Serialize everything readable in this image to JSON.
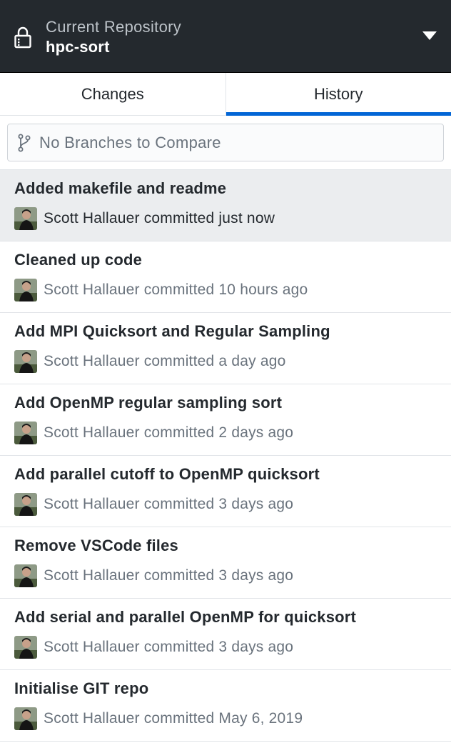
{
  "header": {
    "label": "Current Repository",
    "repo_name": "hpc-sort"
  },
  "tabs": [
    {
      "label": "Changes",
      "selected": false
    },
    {
      "label": "History",
      "selected": true
    }
  ],
  "compare": {
    "placeholder": "No Branches to Compare"
  },
  "commits": [
    {
      "summary": "Added makefile and readme",
      "byline": "Scott Hallauer committed just now",
      "selected": true
    },
    {
      "summary": "Cleaned up code",
      "byline": "Scott Hallauer committed 10 hours ago",
      "selected": false
    },
    {
      "summary": "Add MPI Quicksort and Regular Sampling",
      "byline": "Scott Hallauer committed a day ago",
      "selected": false
    },
    {
      "summary": "Add OpenMP regular sampling sort",
      "byline": "Scott Hallauer committed 2 days ago",
      "selected": false
    },
    {
      "summary": "Add parallel cutoff to OpenMP quicksort",
      "byline": "Scott Hallauer committed 3 days ago",
      "selected": false
    },
    {
      "summary": "Remove VSCode files",
      "byline": "Scott Hallauer committed 3 days ago",
      "selected": false
    },
    {
      "summary": "Add serial and parallel OpenMP for quicksort",
      "byline": "Scott Hallauer committed 3 days ago",
      "selected": false
    },
    {
      "summary": "Initialise GIT repo",
      "byline": "Scott Hallauer committed May 6, 2019",
      "selected": false
    }
  ],
  "icons": {
    "repo": "lock-icon",
    "dropdown": "caret-down-icon",
    "branch": "git-branch-icon",
    "avatar": "avatar"
  },
  "colors": {
    "header_bg": "#24292e",
    "accent": "#0366d6",
    "selected_row": "#ebedef",
    "muted_text": "#6a737d"
  }
}
